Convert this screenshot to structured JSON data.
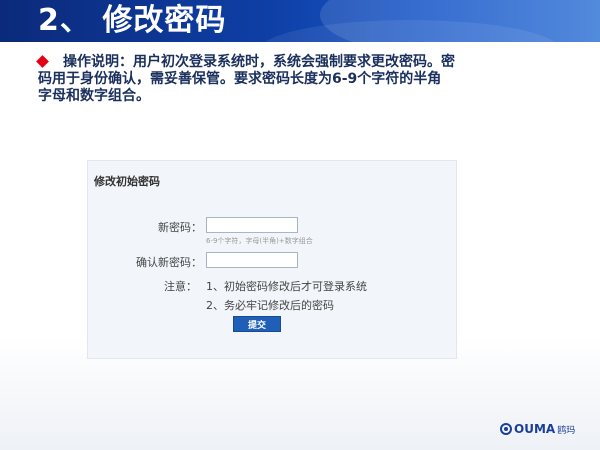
{
  "slide": {
    "title": "2、 修改密码",
    "intro_line1": "操作说明：用户初次登录系统时，系统会强制要求更改密码。密",
    "intro_line2": "码用于身份确认，需妥善保管。要求密码长度为6-9个字符的半角",
    "intro_line3": "字母和数字组合。"
  },
  "form": {
    "title": "修改初始密码",
    "new_password_label": "新密码：",
    "new_password_value": "",
    "new_password_hint": "6-9个字符，字母(半角)+数字组合",
    "confirm_password_label": "确认新密码：",
    "confirm_password_value": "",
    "notes_label": "注意：",
    "note1": "1、初始密码修改后才可登录系统",
    "note2": "2、务必牢记修改后的密码",
    "submit_label": "提交"
  },
  "logo": {
    "brand": "OUMA",
    "brand_cn": "鸥玛"
  },
  "colors": {
    "header_band": "#0e3fa6",
    "title_text": "#ffffff",
    "bullet": "#e60012",
    "intro_text": "#1a2f5c",
    "submit_button": "#1f5fb8",
    "brand": "#1a3f9a"
  }
}
